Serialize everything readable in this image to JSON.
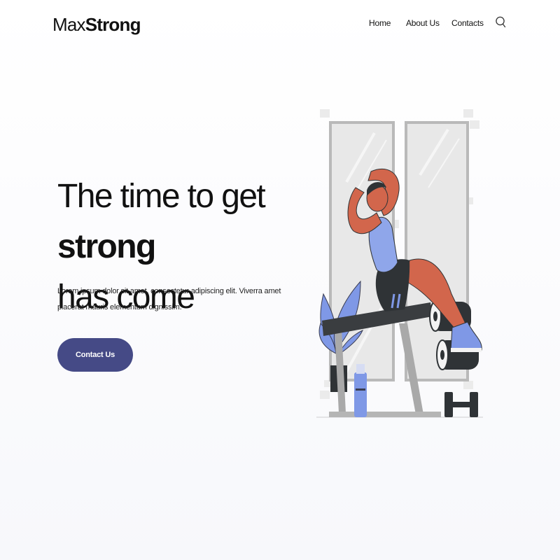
{
  "header": {
    "logo": {
      "light": "Max",
      "bold": "Strong"
    },
    "nav": [
      {
        "label": "Home"
      },
      {
        "label": "About Us"
      },
      {
        "label": "Contacts"
      }
    ],
    "search_icon": "search-icon"
  },
  "hero": {
    "title_normal": "The time to get ",
    "title_bold": "strong",
    "title_line2": "has come",
    "description": "Lorem ipsum dolor sit amet, consectetur adipiscing elit. Viverra amet placerat mauris elementum dignissim.",
    "cta_label": "Contact Us"
  },
  "colors": {
    "accent": "#454a86",
    "skin": "#d2664c",
    "shirt": "#8fa6ea",
    "bench": "#3a3d40"
  },
  "illustration": "person-doing-situps-on-bench"
}
